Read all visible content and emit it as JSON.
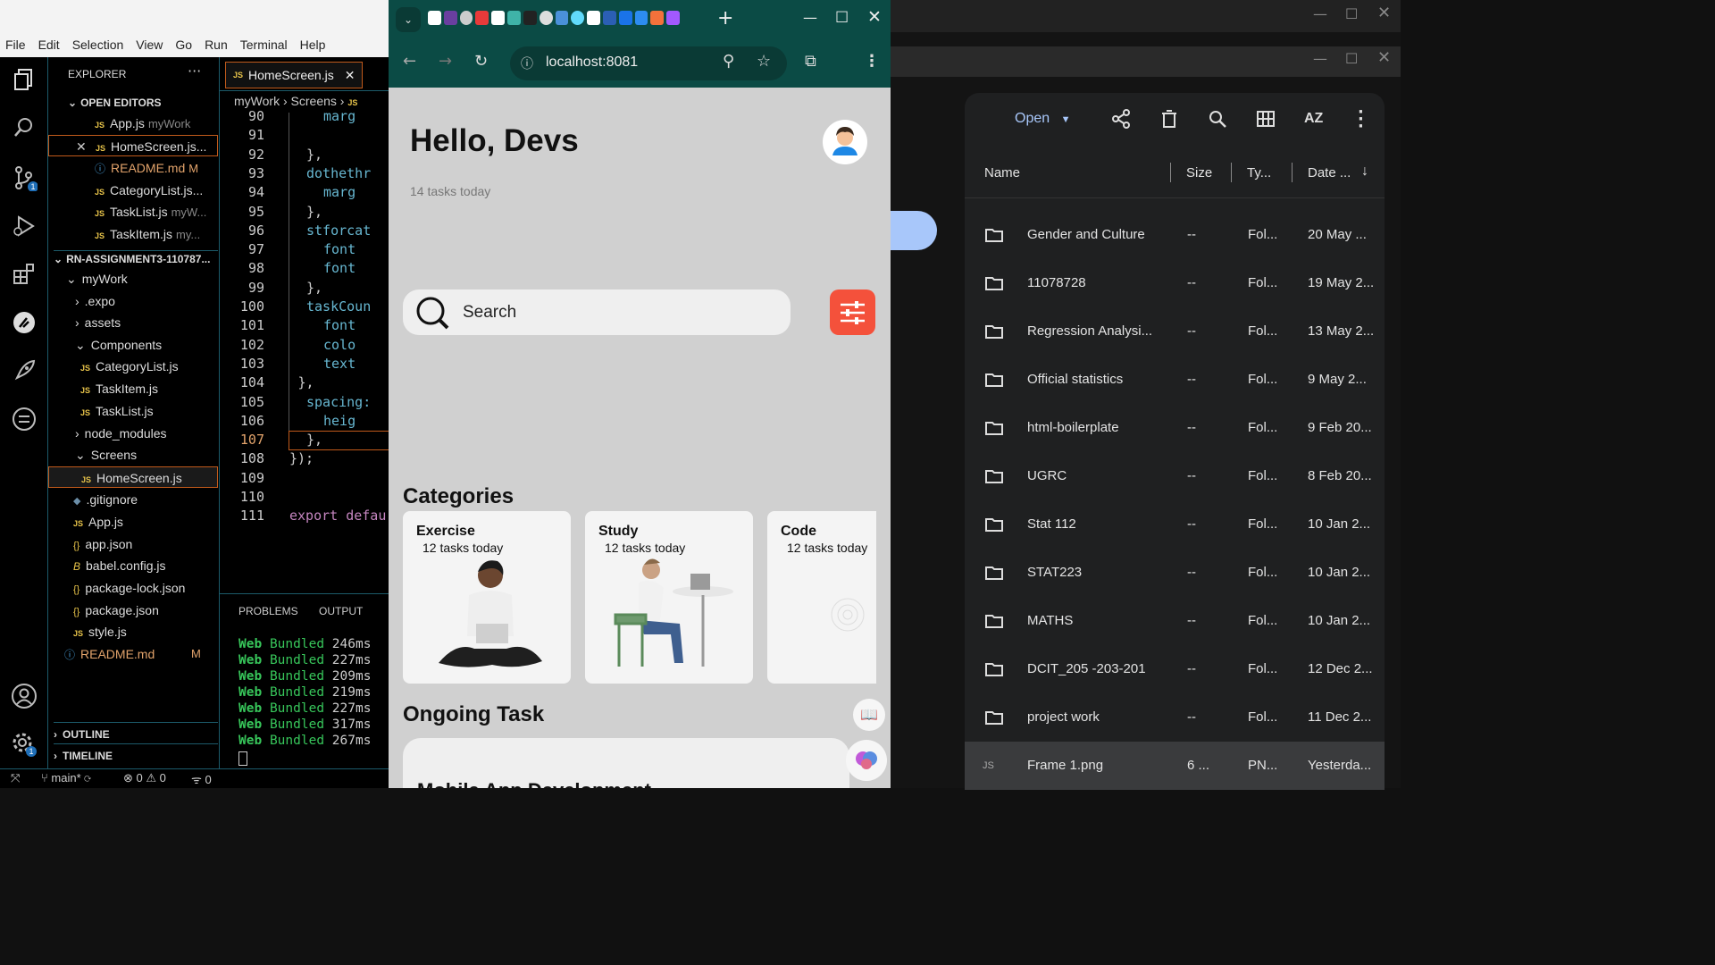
{
  "vscode": {
    "menu": [
      "File",
      "Edit",
      "Selection",
      "View",
      "Go",
      "Run",
      "Terminal",
      "Help"
    ],
    "explorer_title": "EXPLORER",
    "open_editors_label": "OPEN EDITORS",
    "open_editors": [
      {
        "name": "App.js",
        "extra": "myWork"
      },
      {
        "name": "HomeScreen.js...",
        "extra": ""
      },
      {
        "name": "README.md",
        "extra": "M"
      },
      {
        "name": "CategoryList.js...",
        "extra": ""
      },
      {
        "name": "TaskList.js",
        "extra": "myW..."
      },
      {
        "name": "TaskItem.js",
        "extra": "my..."
      }
    ],
    "project_label": "RN-ASSIGNMENT3-110787...",
    "tree": {
      "mywork": "myWork",
      "expo": ".expo",
      "assets": "assets",
      "components": "Components",
      "categorylist": "CategoryList.js",
      "taskitem": "TaskItem.js",
      "tasklist": "TaskList.js",
      "node_modules": "node_modules",
      "screens": "Screens",
      "homescreen": "HomeScreen.js",
      "gitignore": ".gitignore",
      "appjs": "App.js",
      "appjson": "app.json",
      "babel": "babel.config.js",
      "pkglock": "package-lock.json",
      "pkg": "package.json",
      "style": "style.js",
      "readme": "README.md",
      "readme_mod": "M"
    },
    "outline_label": "OUTLINE",
    "timeline_label": "TIMELINE",
    "active_tab": "HomeScreen.js",
    "breadcrumb": [
      "myWork",
      "Screens"
    ],
    "line_numbers": [
      "90",
      "91",
      "92",
      "93",
      "94",
      "95",
      "96",
      "97",
      "98",
      "99",
      "100",
      "101",
      "102",
      "103",
      "104",
      "105",
      "106",
      "107",
      "108",
      "109",
      "110",
      "111"
    ],
    "code_lines": [
      "marg",
      "",
      "},",
      "dothethr",
      "marg",
      "},",
      "stforcat",
      "font",
      "font",
      "},",
      "taskCoun",
      "font",
      "colo",
      "text",
      "},",
      "spacing:",
      "heig",
      "},",
      "});",
      "",
      "",
      "export defau"
    ],
    "panel_tabs": [
      "PROBLEMS",
      "OUTPUT"
    ],
    "terminal_lines": [
      {
        "a": "Web",
        "b": "Bundled",
        "c": "246ms"
      },
      {
        "a": "Web",
        "b": "Bundled",
        "c": "227ms"
      },
      {
        "a": "Web",
        "b": "Bundled",
        "c": "209ms"
      },
      {
        "a": "Web",
        "b": "Bundled",
        "c": "219ms"
      },
      {
        "a": "Web",
        "b": "Bundled",
        "c": "227ms"
      },
      {
        "a": "Web",
        "b": "Bundled",
        "c": "317ms"
      },
      {
        "a": "Web",
        "b": "Bundled",
        "c": "267ms"
      }
    ],
    "status": {
      "branch": "main*",
      "errors": "0",
      "warnings": "0",
      "ports": "0"
    },
    "scm_badge": "1",
    "settings_badge": "1"
  },
  "browser": {
    "url": "localhost:8081",
    "app": {
      "greeting": "Hello, Devs",
      "subtitle": "14 tasks today",
      "search_placeholder": "Search",
      "categories_title": "Categories",
      "categories": [
        {
          "name": "Exercise",
          "tasks": "12 tasks today"
        },
        {
          "name": "Study",
          "tasks": "12 tasks today"
        },
        {
          "name": "Code",
          "tasks": "12 tasks today"
        }
      ],
      "ongoing_title": "Ongoing Task",
      "ongoing_first": "Mobile App Development"
    },
    "colors": {
      "titlebar": "#0b4b45",
      "filter_button": "#f4513b",
      "page_bg": "#d0d0d0"
    }
  },
  "files": {
    "open_label": "Open",
    "columns": {
      "name": "Name",
      "size": "Size",
      "type": "Ty...",
      "date": "Date ..."
    },
    "rows": [
      {
        "name": "Gender and Culture",
        "size": "--",
        "type": "Fol...",
        "date": "20 May ..."
      },
      {
        "name": "11078728",
        "size": "--",
        "type": "Fol...",
        "date": "19 May 2..."
      },
      {
        "name": "Regression Analysi...",
        "size": "--",
        "type": "Fol...",
        "date": "13 May 2..."
      },
      {
        "name": "Official statistics",
        "size": "--",
        "type": "Fol...",
        "date": "9 May 2..."
      },
      {
        "name": "html-boilerplate",
        "size": "--",
        "type": "Fol...",
        "date": "9 Feb 20..."
      },
      {
        "name": "UGRC",
        "size": "--",
        "type": "Fol...",
        "date": "8 Feb 20..."
      },
      {
        "name": "Stat 112",
        "size": "--",
        "type": "Fol...",
        "date": "10 Jan 2..."
      },
      {
        "name": "STAT223",
        "size": "--",
        "type": "Fol...",
        "date": "10 Jan 2..."
      },
      {
        "name": "MATHS",
        "size": "--",
        "type": "Fol...",
        "date": "10 Jan 2..."
      },
      {
        "name": "DCIT_205 -203-201",
        "size": "--",
        "type": "Fol...",
        "date": "12 Dec 2..."
      },
      {
        "name": "project work",
        "size": "--",
        "type": "Fol...",
        "date": "11 Dec 2..."
      },
      {
        "name": "Frame 1.png",
        "size": "6 ...",
        "type": "PN...",
        "date": "Yesterda..."
      }
    ]
  }
}
